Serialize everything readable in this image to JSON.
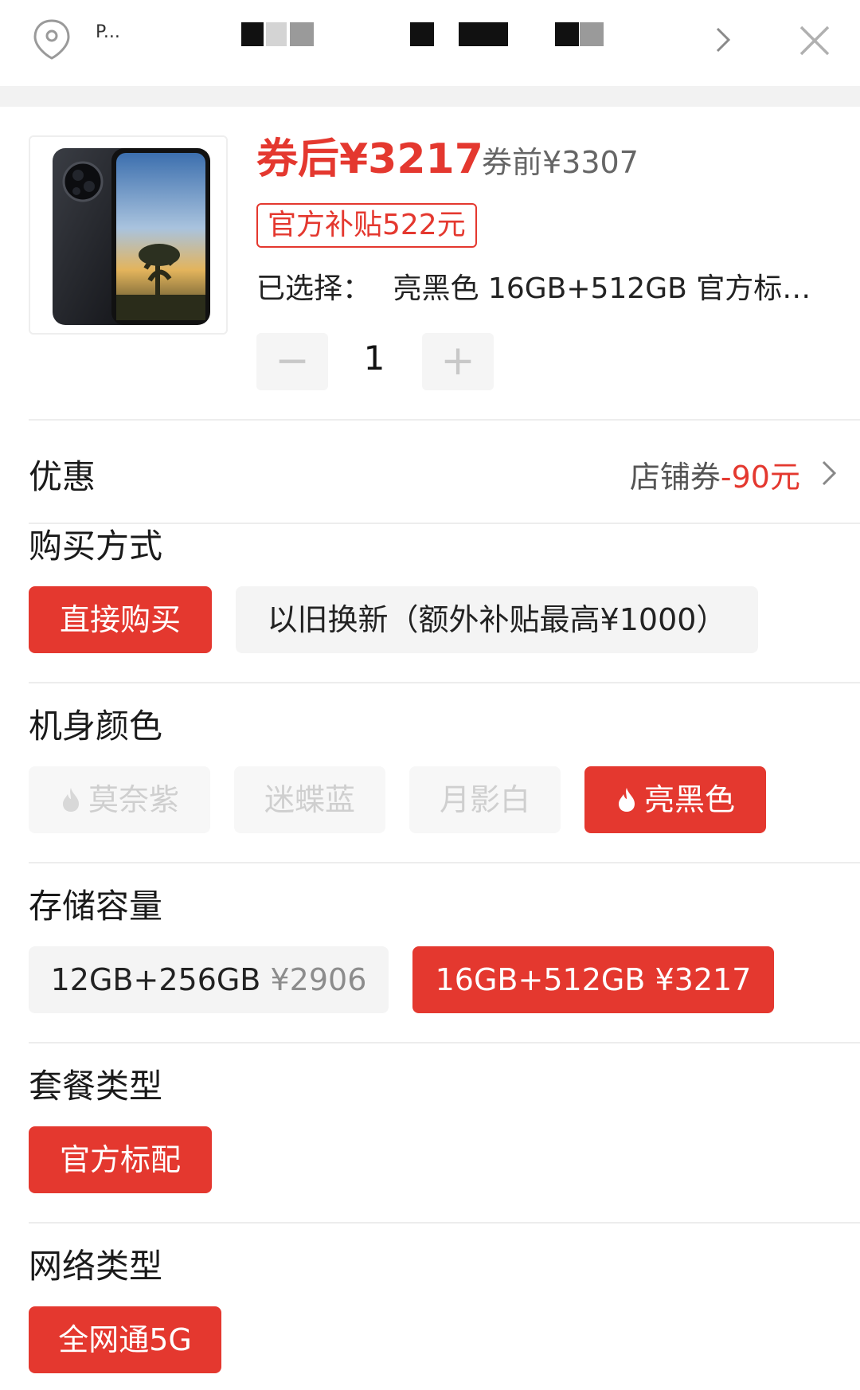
{
  "header": {
    "address_fragment": "P..."
  },
  "product": {
    "price_after": "券后¥3217",
    "price_before": "券前¥3307",
    "subsidy_badge": "官方补贴522元",
    "selected_label": "已选择：",
    "selected_value": "亮黑色 16GB+512GB 官方标配...",
    "quantity": "1",
    "minus": "−",
    "plus": "+"
  },
  "promo": {
    "title": "优惠",
    "coupon_label": "店铺券",
    "coupon_value": "-90元"
  },
  "purchase_method": {
    "title": "购买方式",
    "options": [
      "直接购买",
      "以旧换新（额外补贴最高¥1000）"
    ]
  },
  "color": {
    "title": "机身颜色",
    "options": [
      "莫奈紫",
      "迷蝶蓝",
      "月影白",
      "亮黑色"
    ]
  },
  "storage": {
    "title": "存储容量",
    "options": [
      {
        "label": "12GB+256GB",
        "price": "¥2906"
      },
      {
        "label": "16GB+512GB",
        "price": "¥3217"
      }
    ]
  },
  "package": {
    "title": "套餐类型",
    "options": [
      "官方标配"
    ]
  },
  "network": {
    "title": "网络类型",
    "options": [
      "全网通5G"
    ]
  },
  "colors": {
    "accent": "#e4382f",
    "option_bg": "#f4f4f4",
    "disabled_text": "#cfcfcf"
  }
}
